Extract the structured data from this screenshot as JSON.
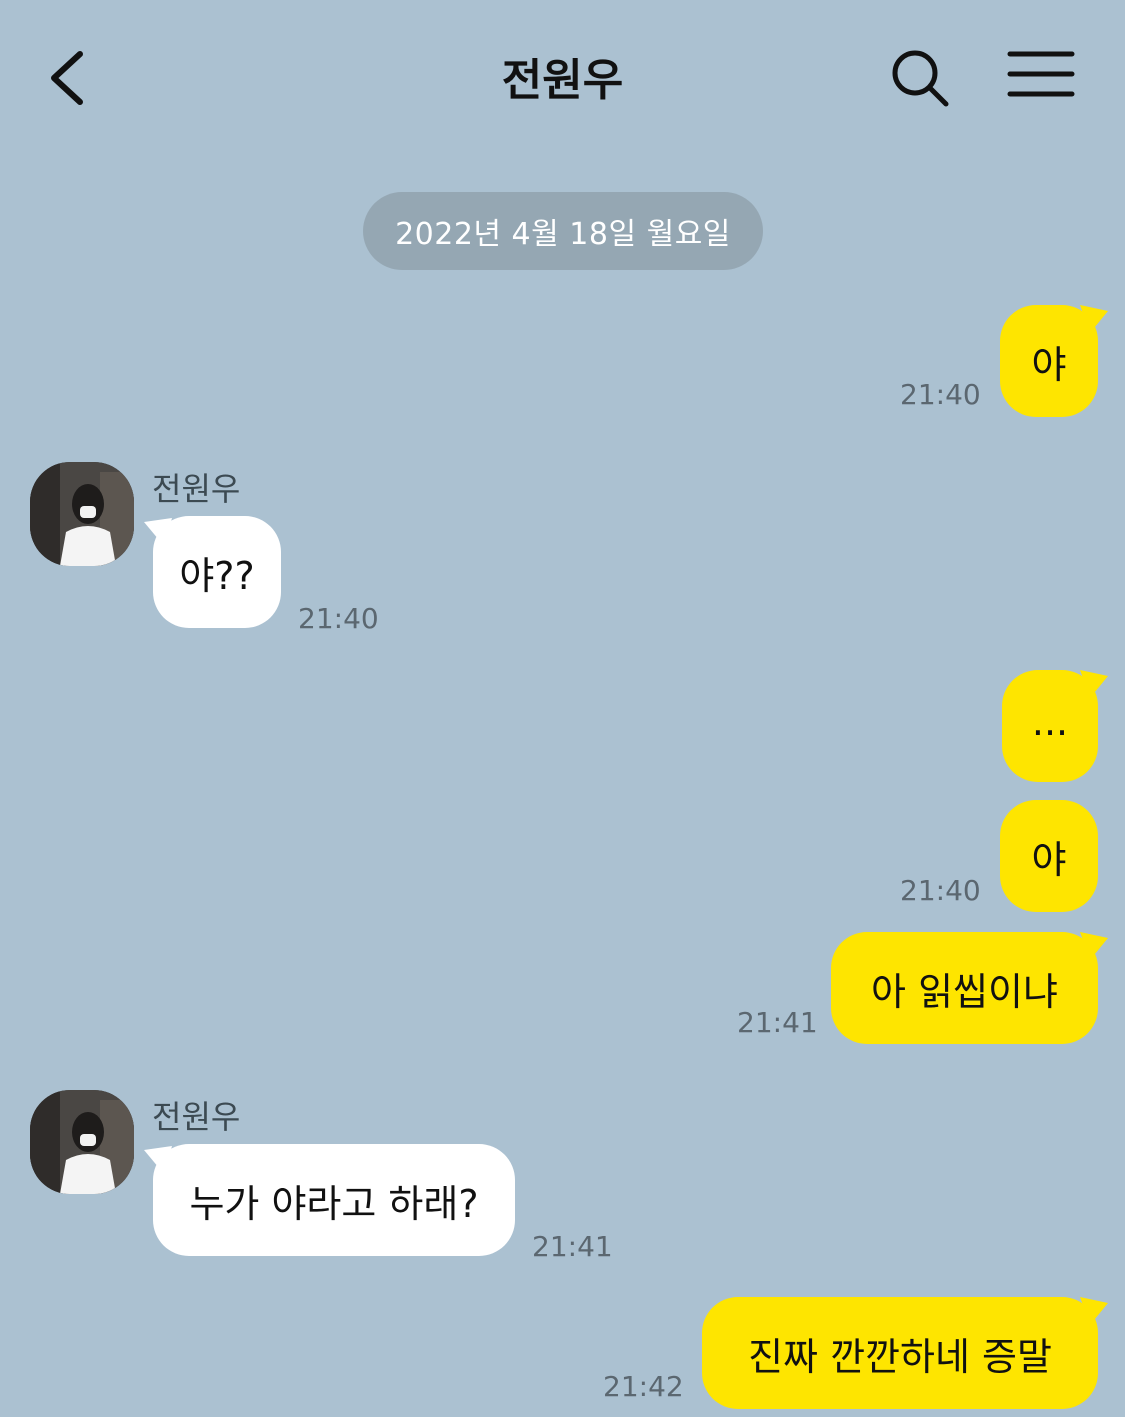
{
  "header": {
    "title": "전원우",
    "back_icon": "chevron-left-icon",
    "search_icon": "search-icon",
    "menu_icon": "menu-icon"
  },
  "date_divider": "2022년 4월 18일 월요일",
  "colors": {
    "background": "#abc1d1",
    "my_bubble": "#fee500",
    "their_bubble": "#ffffff",
    "date_pill": "#95a7b3"
  },
  "messages": [
    {
      "from": "me",
      "text": "야",
      "time": "21:40"
    },
    {
      "from": "them",
      "sender": "전원우",
      "text": "야??",
      "time": "21:40"
    },
    {
      "from": "me",
      "text": "...",
      "time": ""
    },
    {
      "from": "me",
      "text": "야",
      "time": "21:40"
    },
    {
      "from": "me",
      "text": "아 읽씹이냐",
      "time": "21:41"
    },
    {
      "from": "them",
      "sender": "전원우",
      "text": "누가 야라고 하래?",
      "time": "21:41"
    },
    {
      "from": "me",
      "text": "진짜 깐깐하네 증말",
      "time": "21:42"
    }
  ]
}
